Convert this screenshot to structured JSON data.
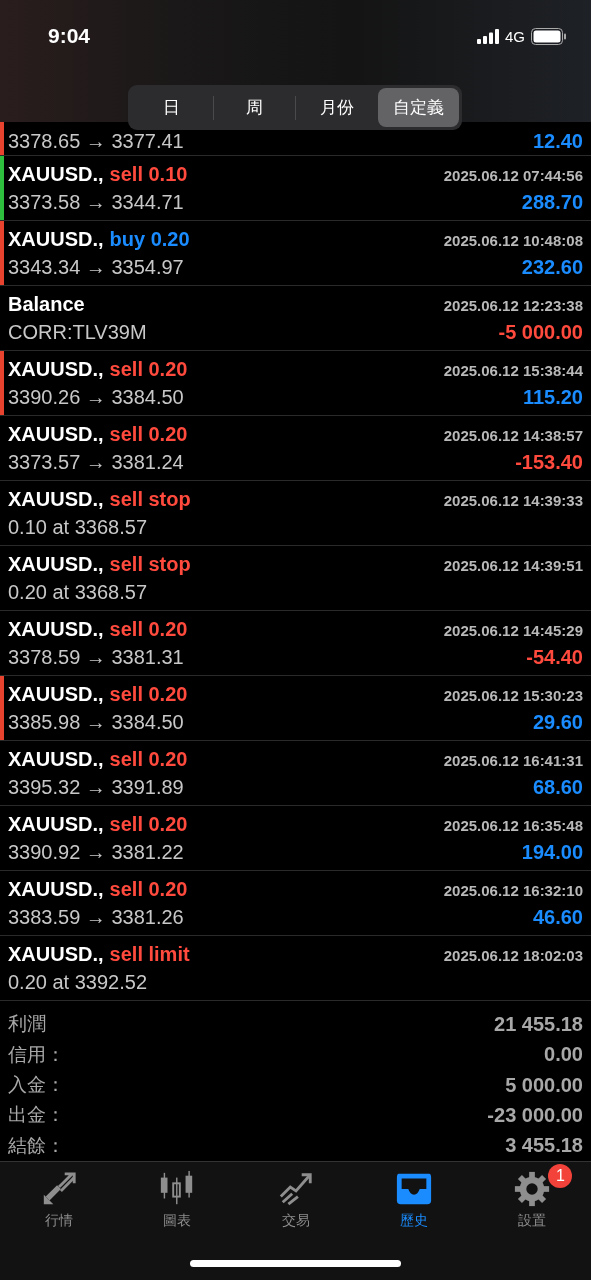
{
  "status_bar": {
    "time": "9:04",
    "network": "4G"
  },
  "tabs": [
    {
      "label": "日",
      "selected": false
    },
    {
      "label": "周",
      "selected": false
    },
    {
      "label": "月份",
      "selected": false
    },
    {
      "label": "自定義",
      "selected": true
    }
  ],
  "rows": [
    {
      "kind": "partial",
      "detail": "3378.65 → 3377.41",
      "profit": "12.40",
      "loss": false,
      "color": "#e8432f"
    },
    {
      "kind": "trade",
      "symbol": "XAUUSD.,",
      "action": "sell 0.10",
      "buy": false,
      "time": "2025.06.12 07:44:56",
      "detail": "3373.58 → 3344.71",
      "profit": "288.70",
      "loss": false,
      "color": "#2fbf3f"
    },
    {
      "kind": "trade",
      "symbol": "XAUUSD.,",
      "action": "buy 0.20",
      "buy": true,
      "time": "2025.06.12 10:48:08",
      "detail": "3343.34 → 3354.97",
      "profit": "232.60",
      "loss": false,
      "color": "#e8432f"
    },
    {
      "kind": "balance",
      "symbol": "Balance",
      "time": "2025.06.12 12:23:38",
      "detail": "CORR:TLV39M",
      "profit": "-5 000.00",
      "loss": true
    },
    {
      "kind": "trade",
      "symbol": "XAUUSD.,",
      "action": "sell 0.20",
      "buy": false,
      "time": "2025.06.12 15:38:44",
      "detail": "3390.26 → 3384.50",
      "profit": "115.20",
      "loss": false,
      "color": "#e8432f"
    },
    {
      "kind": "trade",
      "symbol": "XAUUSD.,",
      "action": "sell 0.20",
      "buy": false,
      "time": "2025.06.12 14:38:57",
      "detail": "3373.57 → 3381.24",
      "profit": "-153.40",
      "loss": true
    },
    {
      "kind": "order",
      "symbol": "XAUUSD.,",
      "action": "sell stop",
      "buy": false,
      "time": "2025.06.12 14:39:33",
      "detail": "0.10 at 3368.57"
    },
    {
      "kind": "order",
      "symbol": "XAUUSD.,",
      "action": "sell stop",
      "buy": false,
      "time": "2025.06.12 14:39:51",
      "detail": "0.20 at 3368.57"
    },
    {
      "kind": "trade",
      "symbol": "XAUUSD.,",
      "action": "sell 0.20",
      "buy": false,
      "time": "2025.06.12 14:45:29",
      "detail": "3378.59 → 3381.31",
      "profit": "-54.40",
      "loss": true
    },
    {
      "kind": "trade",
      "symbol": "XAUUSD.,",
      "action": "sell 0.20",
      "buy": false,
      "time": "2025.06.12 15:30:23",
      "detail": "3385.98 → 3384.50",
      "profit": "29.60",
      "loss": false,
      "color": "#e8432f"
    },
    {
      "kind": "trade",
      "symbol": "XAUUSD.,",
      "action": "sell 0.20",
      "buy": false,
      "time": "2025.06.12 16:41:31",
      "detail": "3395.32 → 3391.89",
      "profit": "68.60",
      "loss": false
    },
    {
      "kind": "trade",
      "symbol": "XAUUSD.,",
      "action": "sell 0.20",
      "buy": false,
      "time": "2025.06.12 16:35:48",
      "detail": "3390.92 → 3381.22",
      "profit": "194.00",
      "loss": false
    },
    {
      "kind": "trade",
      "symbol": "XAUUSD.,",
      "action": "sell 0.20",
      "buy": false,
      "time": "2025.06.12 16:32:10",
      "detail": "3383.59 → 3381.26",
      "profit": "46.60",
      "loss": false
    },
    {
      "kind": "order",
      "symbol": "XAUUSD.,",
      "action": "sell limit",
      "buy": false,
      "time": "2025.06.12 18:02:03",
      "detail": "0.20 at 3392.52"
    }
  ],
  "summary": [
    {
      "label": "利潤",
      "value": "21 455.18"
    },
    {
      "label": "信用：",
      "value": "0.00"
    },
    {
      "label": "入金：",
      "value": "5 000.00"
    },
    {
      "label": "出金：",
      "value": "-23 000.00"
    },
    {
      "label": "結餘：",
      "value": "3 455.18"
    }
  ],
  "nav": [
    {
      "kind": "quotes",
      "label": "行情",
      "selected": false
    },
    {
      "kind": "chart",
      "label": "圖表",
      "selected": false
    },
    {
      "kind": "trade",
      "label": "交易",
      "selected": false
    },
    {
      "kind": "history",
      "label": "歷史",
      "selected": true
    },
    {
      "kind": "settings",
      "label": "設置",
      "selected": false,
      "badge": "1"
    }
  ]
}
